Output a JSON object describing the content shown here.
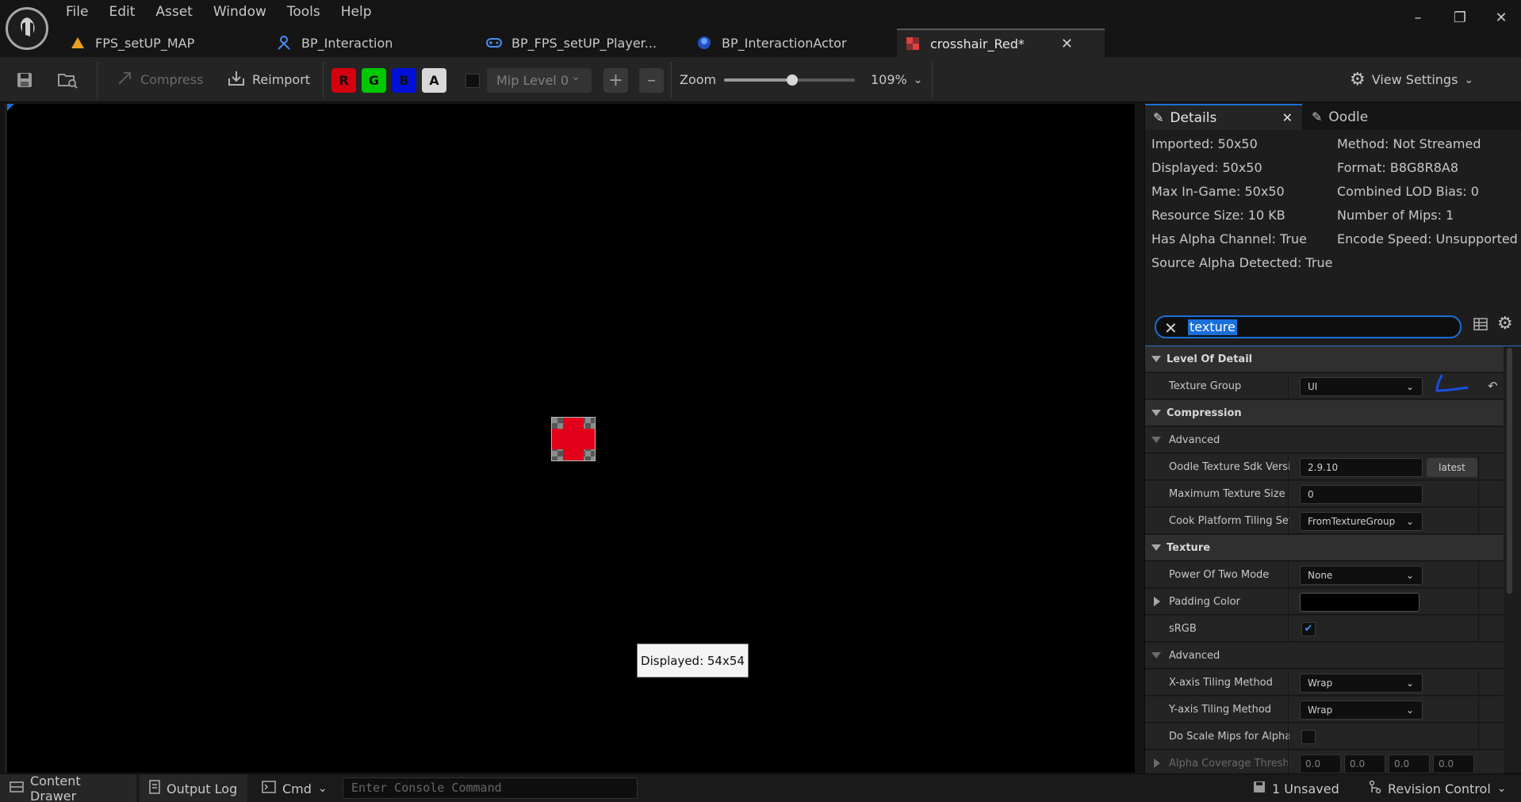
{
  "menu": [
    "File",
    "Edit",
    "Asset",
    "Window",
    "Tools",
    "Help"
  ],
  "tabs": [
    {
      "label": "FPS_setUP_MAP",
      "icon": "level-icon"
    },
    {
      "label": "BP_Interaction",
      "icon": "blueprint-icon"
    },
    {
      "label": "BP_FPS_setUP_Player...",
      "icon": "gamepad-icon"
    },
    {
      "label": "BP_InteractionActor",
      "icon": "actor-icon"
    },
    {
      "label": "crosshair_Red*",
      "icon": "texture-icon",
      "active": true
    }
  ],
  "toolbar": {
    "compress": "Compress",
    "reimport": "Reimport",
    "channels": [
      {
        "label": "R",
        "color": "#d4000e"
      },
      {
        "label": "G",
        "color": "#00c800"
      },
      {
        "label": "B",
        "color": "#0010d8"
      },
      {
        "label": "A",
        "color": "#d8d8d8"
      }
    ],
    "mip_level": "Mip Level 0",
    "zoom_label": "Zoom",
    "zoom_value": "109%",
    "zoom_fraction": 0.52,
    "view_settings": "View Settings"
  },
  "viewport": {
    "tooltip": "Displayed: 54x54"
  },
  "details": {
    "tab_details": "Details",
    "tab_oodle": "Oodle",
    "info_left": [
      "Imported: 50x50",
      "Displayed: 50x50",
      "Max In-Game: 50x50",
      "Resource Size: 10 KB",
      "Has Alpha Channel: True",
      "Source Alpha Detected: True"
    ],
    "info_right": [
      "Method: Not Streamed",
      "Format: B8G8R8A8",
      "Combined LOD Bias: 0",
      "Number of Mips: 1",
      "Encode Speed: Unsupported"
    ],
    "search_value": "texture",
    "rows": {
      "lod": "Level Of Detail",
      "texture_group": "Texture Group",
      "texture_group_value": "UI",
      "compression": "Compression",
      "advanced": "Advanced",
      "oodle_sdk": "Oodle Texture Sdk Versi...",
      "oodle_sdk_value": "2.9.10",
      "latest": "latest",
      "max_tex_size": "Maximum Texture Size",
      "max_tex_size_value": "0",
      "cook_tiling": "Cook Platform Tiling Set...",
      "cook_tiling_value": "FromTextureGroup",
      "texture": "Texture",
      "pow2": "Power Of Two Mode",
      "pow2_value": "None",
      "padding_color": "Padding Color",
      "srgb": "sRGB",
      "advanced2": "Advanced",
      "x_tiling": "X-axis Tiling Method",
      "x_tiling_value": "Wrap",
      "y_tiling": "Y-axis Tiling Method",
      "y_tiling_value": "Wrap",
      "scale_mips": "Do Scale Mips for Alpha...",
      "alpha_cov": "Alpha Coverage Thresho...",
      "alpha_cov_values": [
        "0.0",
        "0.0",
        "0.0",
        "0.0"
      ]
    }
  },
  "status": {
    "content_drawer": "Content Drawer",
    "output_log": "Output Log",
    "cmd": "Cmd",
    "console_placeholder": "Enter Console Command",
    "unsaved": "1 Unsaved",
    "revision": "Revision Control"
  }
}
